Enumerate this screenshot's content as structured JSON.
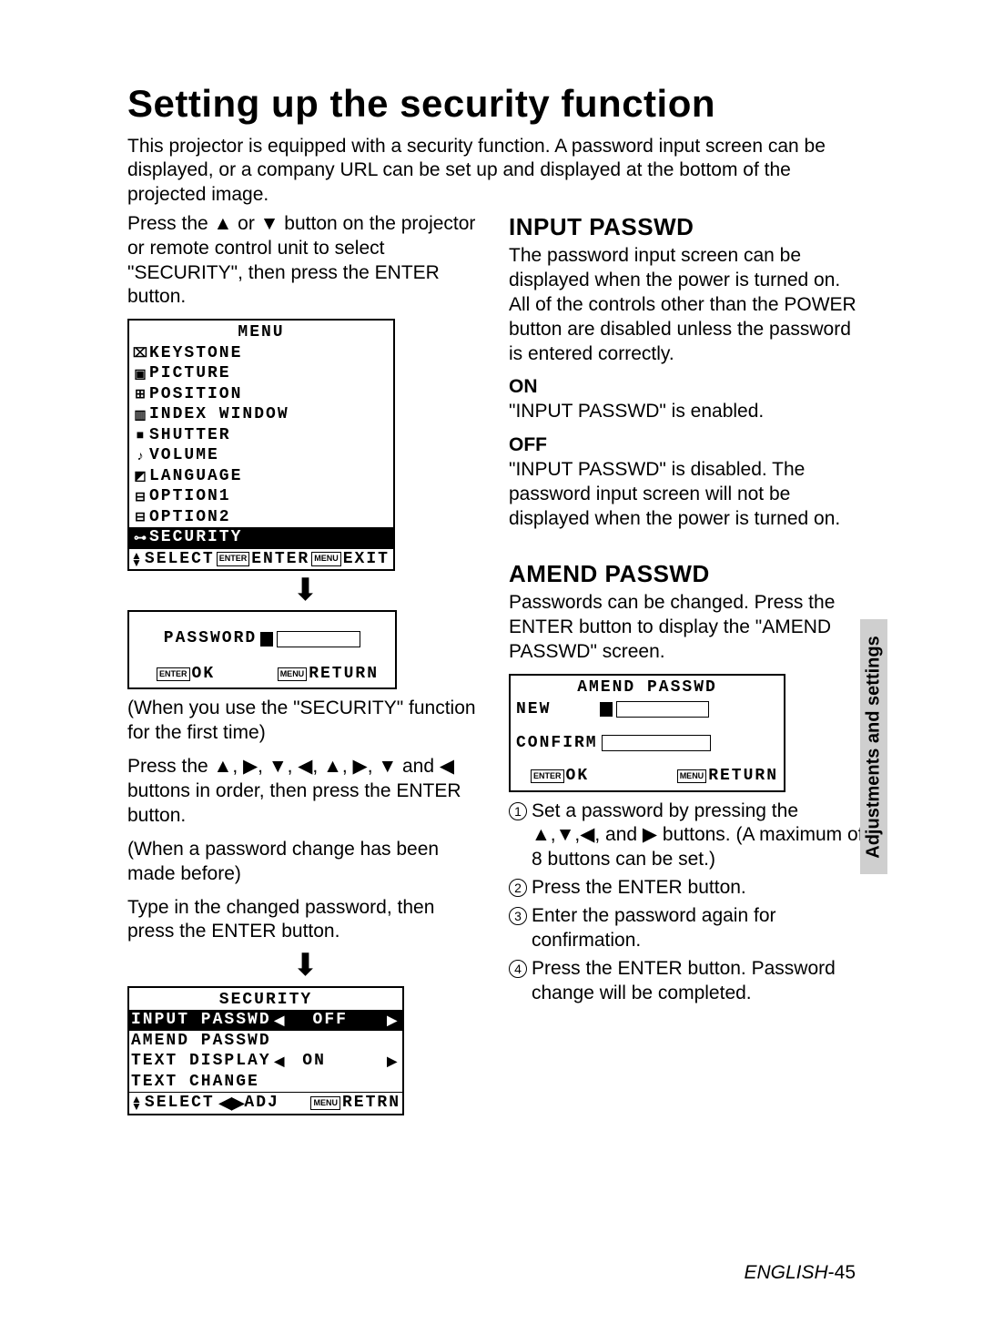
{
  "title": "Setting up the security function",
  "intro": "This projector is equipped with a security function. A password input screen can be displayed, or a company URL can be set up and displayed at the bottom of the projected image.",
  "left": {
    "press_instr_1": "Press the ▲ or ▼ button on the projector or remote control unit to select \"SECURITY\", then press the ENTER button.",
    "menu": {
      "title": "MENU",
      "items": [
        "KEYSTONE",
        "PICTURE",
        "POSITION",
        "INDEX WINDOW",
        "SHUTTER",
        "VOLUME",
        "LANGUAGE",
        "OPTION1",
        "OPTION2",
        "SECURITY"
      ],
      "footer_select": "SELECT",
      "footer_enter_badge": "ENTER",
      "footer_enter": "ENTER",
      "footer_exit_badge": "MENU",
      "footer_exit": "EXIT"
    },
    "password_box": {
      "label": "PASSWORD",
      "ok_badge": "ENTER",
      "ok": "OK",
      "return_badge": "MENU",
      "return": "RETURN"
    },
    "first_time_1": "(When you use the \"SECURITY\" function for the first time)",
    "first_time_2": "Press the ▲, ▶, ▼, ◀, ▲, ▶, ▼ and ◀ buttons in order, then press the ENTER button.",
    "changed_1": "(When a password change has been made before)",
    "changed_2": "Type in the changed password, then press the ENTER button.",
    "security_menu": {
      "title": "SECURITY",
      "rows": [
        {
          "label": "INPUT PASSWD",
          "value": "OFF",
          "sel": true,
          "arrows": true
        },
        {
          "label": "AMEND PASSWD",
          "value": "",
          "sel": false,
          "arrows": false
        },
        {
          "label": "TEXT DISPLAY",
          "value": "ON",
          "sel": false,
          "arrows": true
        },
        {
          "label": "TEXT CHANGE",
          "value": "",
          "sel": false,
          "arrows": false
        }
      ],
      "footer_select": "SELECT",
      "footer_adj": "ADJ",
      "footer_retrn_badge": "MENU",
      "footer_retrn": "RETRN"
    }
  },
  "right": {
    "input_h": "INPUT PASSWD",
    "input_p": "The password input screen can be displayed when the power is turned on. All of the controls other than the POWER button are disabled unless the password is entered correctly.",
    "on_label": "ON",
    "on_text": "\"INPUT PASSWD\" is enabled.",
    "off_label": "OFF",
    "off_text": "\"INPUT PASSWD\" is disabled. The password input screen will not be displayed when the power is turned on.",
    "amend_h": "AMEND PASSWD",
    "amend_p": "Passwords can be changed. Press the ENTER button to display the \"AMEND PASSWD\" screen.",
    "amend_box": {
      "title": "AMEND PASSWD",
      "new": "NEW",
      "confirm": "CONFIRM",
      "ok_badge": "ENTER",
      "ok": "OK",
      "return_badge": "MENU",
      "return": "RETURN"
    },
    "steps": [
      "Set a password by pressing the ▲,▼,◀, and ▶ buttons.\n(A maximum of 8 buttons can be set.)",
      "Press the ENTER button.",
      "Enter the password again for confirmation.",
      "Press the ENTER button. Password change will be completed."
    ]
  },
  "side_tab": "Adjustments and settings",
  "footer_lang": "ENGLISH",
  "footer_page": "-45"
}
